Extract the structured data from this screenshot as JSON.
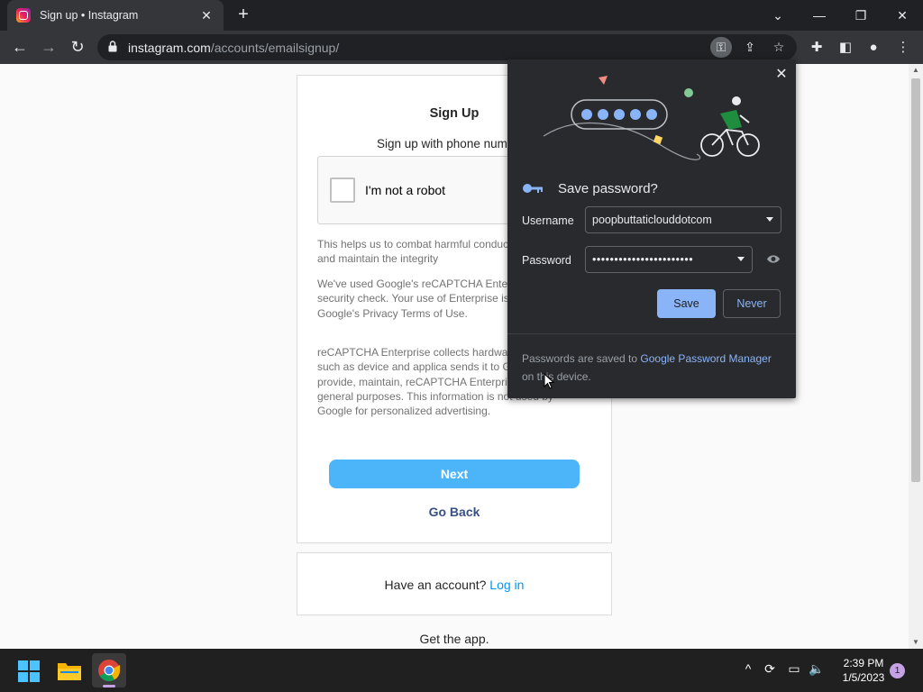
{
  "browser": {
    "tab_title": "Sign up • Instagram",
    "url_host": "instagram.com",
    "url_path": "/accounts/emailsignup/"
  },
  "page": {
    "heading": "Sign Up",
    "subheading": "Sign up with phone num",
    "captcha_label": "I'm not a robot",
    "para1": "This helps us to combat harmful conduc prevent spam and maintain the integrity",
    "para2": "We've used Google's reCAPTCHA Ente provide this security check. Your use of Enterprise is subject to Google's Privacy Terms of Use.",
    "para3": "reCAPTCHA Enterprise collects hardwa information, such as device and applica sends it to Google to provide, maintain, reCAPTCHA Enterprise and for general purposes. This information is not used by Google for personalized advertising.",
    "next_label": "Next",
    "goback_label": "Go Back",
    "have_account": "Have an account?",
    "login_label": "Log in",
    "get_app": "Get the app."
  },
  "password_bubble": {
    "title": "Save password?",
    "username_label": "Username",
    "username_value": "poopbuttaticlouddotcom",
    "password_label": "Password",
    "password_value": "•••••••••••••••••••••••",
    "save_label": "Save",
    "never_label": "Never",
    "footer_prefix": "Passwords are saved to ",
    "footer_link": "Google Password Manager",
    "footer_suffix": " on this device."
  },
  "taskbar": {
    "time": "2:39 PM",
    "date": "1/5/2023",
    "notification_count": "1"
  },
  "colors": {
    "accent_blue": "#8ab4f8",
    "instagram_button": "#4cb5f9",
    "link_blue": "#0095f6"
  }
}
